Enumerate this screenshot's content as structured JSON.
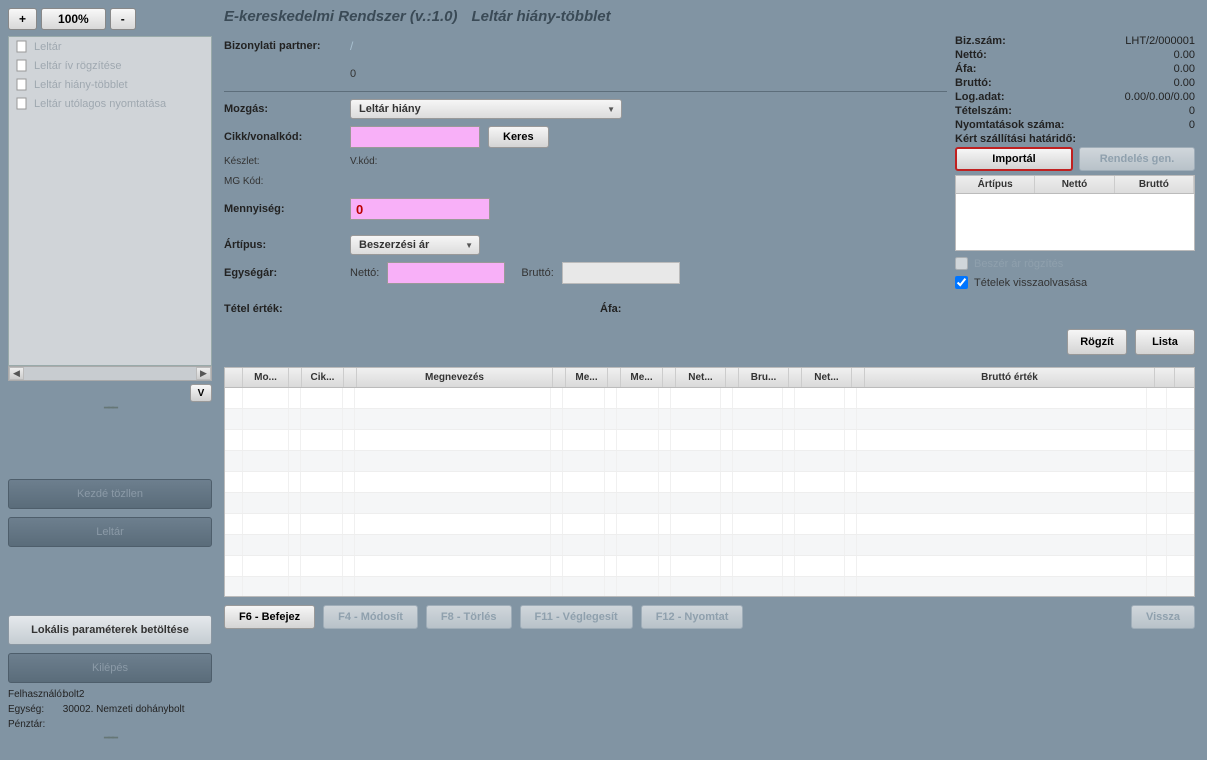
{
  "zoom": {
    "plus": "+",
    "pct": "100%",
    "minus": "-"
  },
  "tree": [
    "Leltár",
    "Leltár ív rögzítése",
    "Leltár hiány-többlet",
    "Leltár utólagos nyomtatása"
  ],
  "v_btn": "V",
  "side_buttons": {
    "btn1": "Kezdé tözllen",
    "btn2": "Leltár",
    "params": "Lokális paraméterek betöltése",
    "exit": "Kilépés"
  },
  "user_info": {
    "user_lbl": "Felhasználó:",
    "user": "bolt2",
    "unit_lbl": "Egység:",
    "unit": "30002. Nemzeti dohánybolt",
    "cash_lbl": "Pénztár:"
  },
  "title": {
    "app": "E-kereskedelmi Rendszer (v.:1.0)",
    "page": "Leltár hiány-többlet"
  },
  "form": {
    "partner_lbl": "Bizonylati partner:",
    "partner_val": "/",
    "partner_sub": "0",
    "mozgas_lbl": "Mozgás:",
    "mozgas_val": "Leltár hiány",
    "cikk_lbl": "Cikk/vonalkód:",
    "keres": "Keres",
    "keszlet_lbl": "Készlet:",
    "mg_lbl": "MG Kód:",
    "vkod_lbl": "V.kód:",
    "menny_lbl": "Mennyiség:",
    "menny_val": "0",
    "artipus_lbl": "Ártípus:",
    "artipus_val": "Beszerzési ár",
    "egysegar_lbl": "Egységár:",
    "netto_lbl": "Nettó:",
    "brutto_lbl": "Bruttó:",
    "tetel_lbl": "Tétel érték:",
    "afa_lbl": "Áfa:"
  },
  "summary": {
    "bizm_lbl": "Biz.szám:",
    "bizm": "LHT/2/000001",
    "netto_lbl": "Nettó:",
    "netto": "0.00",
    "afa_lbl": "Áfa:",
    "afa": "0.00",
    "brutto_lbl": "Bruttó:",
    "brutto": "0.00",
    "log_lbl": "Log.adat:",
    "log": "0.00/0.00/0.00",
    "tetel_lbl": "Tételszám:",
    "tetel": "0",
    "nyom_lbl": "Nyomtatások száma:",
    "nyom": "0",
    "hatarido_lbl": "Kért szállítási határidő:",
    "import": "Importál",
    "rendeles": "Rendelés gen.",
    "mini_headers": {
      "a": "Ártípus",
      "b": "Nettó",
      "c": "Bruttó"
    },
    "chk_beszer": "Beszér ár rögzítés",
    "chk_tetelek": "Tételek visszaolvasása",
    "rogzit": "Rögzít",
    "lista": "Lista"
  },
  "table": {
    "headers": [
      "",
      "Mo...",
      "",
      "Cik...",
      "",
      "Megnevezés",
      "",
      "Me...",
      "",
      "Me...",
      "",
      "Net...",
      "",
      "Bru...",
      "",
      "Net...",
      "",
      "Bruttó érték",
      ""
    ],
    "widths": [
      18,
      46,
      12,
      42,
      12,
      196,
      12,
      42,
      12,
      42,
      12,
      50,
      12,
      50,
      12,
      50,
      12,
      290,
      20
    ]
  },
  "bottom": {
    "f6": "F6 - Befejez",
    "f4": "F4 - Módosít",
    "f8": "F8 - Törlés",
    "f11": "F11 - Véglegesít",
    "f12": "F12 - Nyomtat",
    "back": "Vissza"
  }
}
